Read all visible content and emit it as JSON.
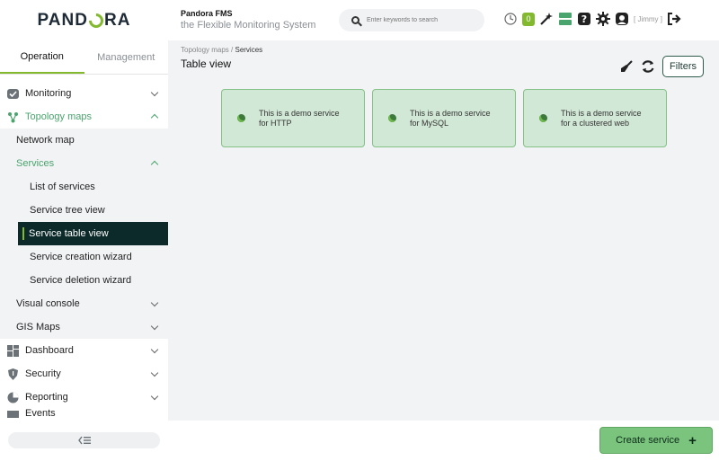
{
  "app": {
    "logo": "PANDORA",
    "brand_title": "Pandora FMS",
    "brand_subtitle": "the Flexible Monitoring System"
  },
  "search": {
    "placeholder": "Enter keywords to search"
  },
  "header": {
    "notification_count": "0",
    "user": "[ Jimmy ]"
  },
  "sidebar": {
    "tabs": [
      "Operation",
      "Management"
    ],
    "items": [
      {
        "label": "Monitoring"
      },
      {
        "label": "Topology maps"
      },
      {
        "label": "Network map"
      },
      {
        "label": "Services"
      },
      {
        "label": "List of services"
      },
      {
        "label": "Service tree view"
      },
      {
        "label": "Service table view"
      },
      {
        "label": "Service creation wizard"
      },
      {
        "label": "Service deletion wizard"
      },
      {
        "label": "Visual console"
      },
      {
        "label": "GIS Maps"
      },
      {
        "label": "Dashboard"
      },
      {
        "label": "Security"
      },
      {
        "label": "Reporting"
      },
      {
        "label": "Events"
      }
    ]
  },
  "breadcrumb": {
    "parent": "Topology maps",
    "separator": " / ",
    "current": "Services"
  },
  "page": {
    "title": "Table view",
    "filters_label": "Filters"
  },
  "services": [
    {
      "name": "This is a demo service for HTTP"
    },
    {
      "name": "This is a demo service for MySQL"
    },
    {
      "name": "This is a demo service for a clustered web"
    }
  ],
  "footer": {
    "create_label": "Create service",
    "create_icon": "+"
  },
  "colors": {
    "accent": "#82b92e",
    "selected_bg": "#0c2a2a",
    "card_bg": "#d2e8d6",
    "card_border": "#84c186",
    "create_bg": "#7ac47d"
  }
}
